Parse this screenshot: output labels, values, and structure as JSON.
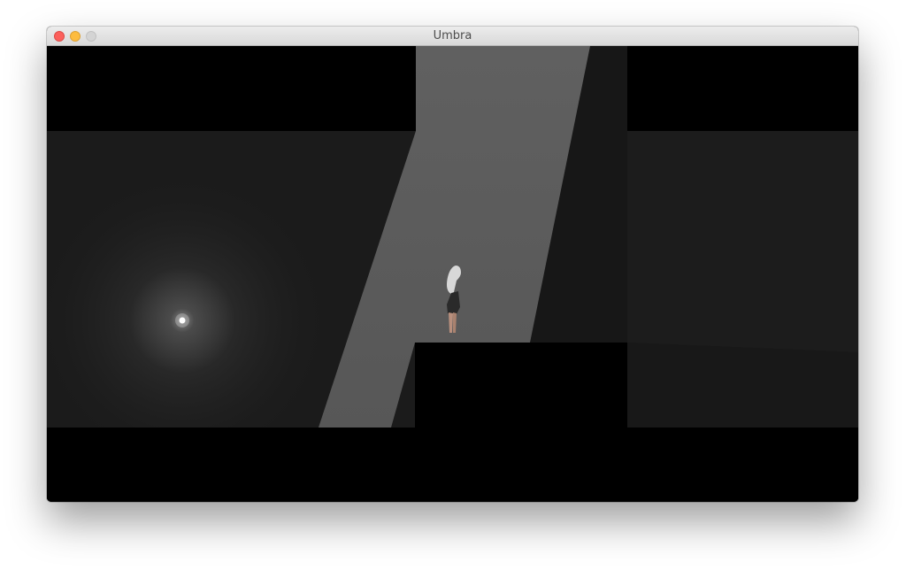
{
  "window": {
    "title": "Umbra"
  },
  "titlebar": {
    "buttons": [
      {
        "name": "close",
        "color": "#fc605c"
      },
      {
        "name": "minimize",
        "color": "#fdbc40"
      },
      {
        "name": "zoom",
        "color": "#d4d4d4"
      }
    ]
  },
  "scene": {
    "background_color": "#000000",
    "wall_color": "#1b1b1b",
    "light_beam_color": "#5a5a5a",
    "glow_color": "#ffffff",
    "character": {
      "hair_color": "#d8d8d8",
      "coat_color": "#2a2a2a",
      "skin_color": "#b88f7d"
    }
  }
}
